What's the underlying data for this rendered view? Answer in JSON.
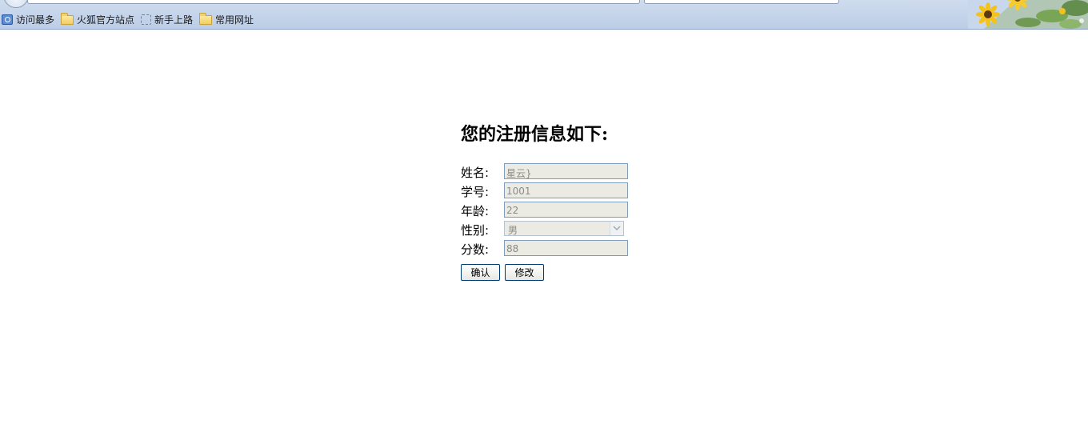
{
  "browser": {
    "bookmarks": [
      {
        "label": "访问最多",
        "icon": "most-visited-icon"
      },
      {
        "label": "火狐官方站点",
        "icon": "folder-icon"
      },
      {
        "label": "新手上路",
        "icon": "dashed-box-icon"
      },
      {
        "label": "常用网址",
        "icon": "folder-icon"
      }
    ]
  },
  "page": {
    "title": "您的注册信息如下:",
    "fields": [
      {
        "label": "姓名:",
        "value": "星云}"
      },
      {
        "label": "学号:",
        "value": "1001"
      },
      {
        "label": "年龄:",
        "value": "22"
      },
      {
        "label": "性别:",
        "value": "男"
      },
      {
        "label": "分数:",
        "value": "88"
      }
    ],
    "buttons": {
      "confirm": "确认",
      "modify": "修改"
    }
  }
}
